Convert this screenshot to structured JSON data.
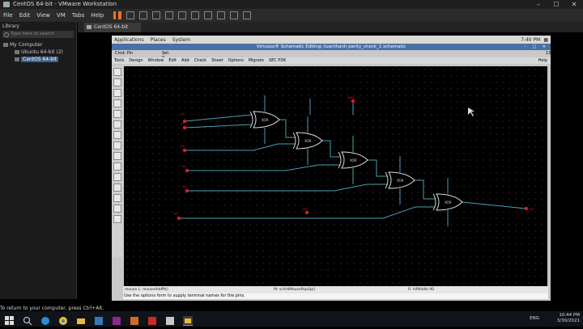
{
  "vmware": {
    "title": "CentOS 64-bit - VMware Workstation",
    "menu": [
      "File",
      "Edit",
      "View",
      "VM",
      "Tabs",
      "Help"
    ],
    "tab": "CentOS 64-bit"
  },
  "library": {
    "header": "Library",
    "search_placeholder": "Type here to search",
    "root": "My Computer",
    "items": [
      "Ubuntu 64-bit (2)",
      "CentOS 64-bit"
    ]
  },
  "gnome": {
    "menus": [
      "Applications",
      "Places",
      "System"
    ],
    "clock": "7:40 PM"
  },
  "virtuoso": {
    "window_title": "Virtuoso® Schematic Editing: tuanthanh parity_check_1 schematic",
    "cmd_label": "Cmd: Pin",
    "sel_label": "Sel: 0",
    "num_label": "13",
    "menu": [
      "Tools",
      "Design",
      "Window",
      "Edit",
      "Add",
      "Check",
      "Sheet",
      "Options",
      "Migrate",
      "SEC PDK"
    ],
    "help": "Help",
    "bindings": [
      "mouse L: mouseAddPt()",
      "M: schHiMousePopUp()",
      "R: hiMiddle 90"
    ],
    "help_line": "Use the options form to supply terminal names for the pins."
  },
  "toast": "To return to your computer, press Ctrl+Alt.",
  "taskbar": {
    "lang": "ENG",
    "time": "10:44 PM",
    "date": "3/30/2021"
  },
  "schematic": {
    "gate_labels": [
      "XOR",
      "XOR",
      "XOR",
      "XOR",
      "XOR"
    ],
    "pins": [
      "A0",
      "A1",
      "A2",
      "A3",
      "A4",
      "A5",
      "VDD",
      "VSS",
      "OUT"
    ]
  },
  "colors": {
    "wire": "#4aa0b4",
    "pin": "#e0182a",
    "gate": "#d8d8d8",
    "accent_pause": "#e8752a"
  }
}
